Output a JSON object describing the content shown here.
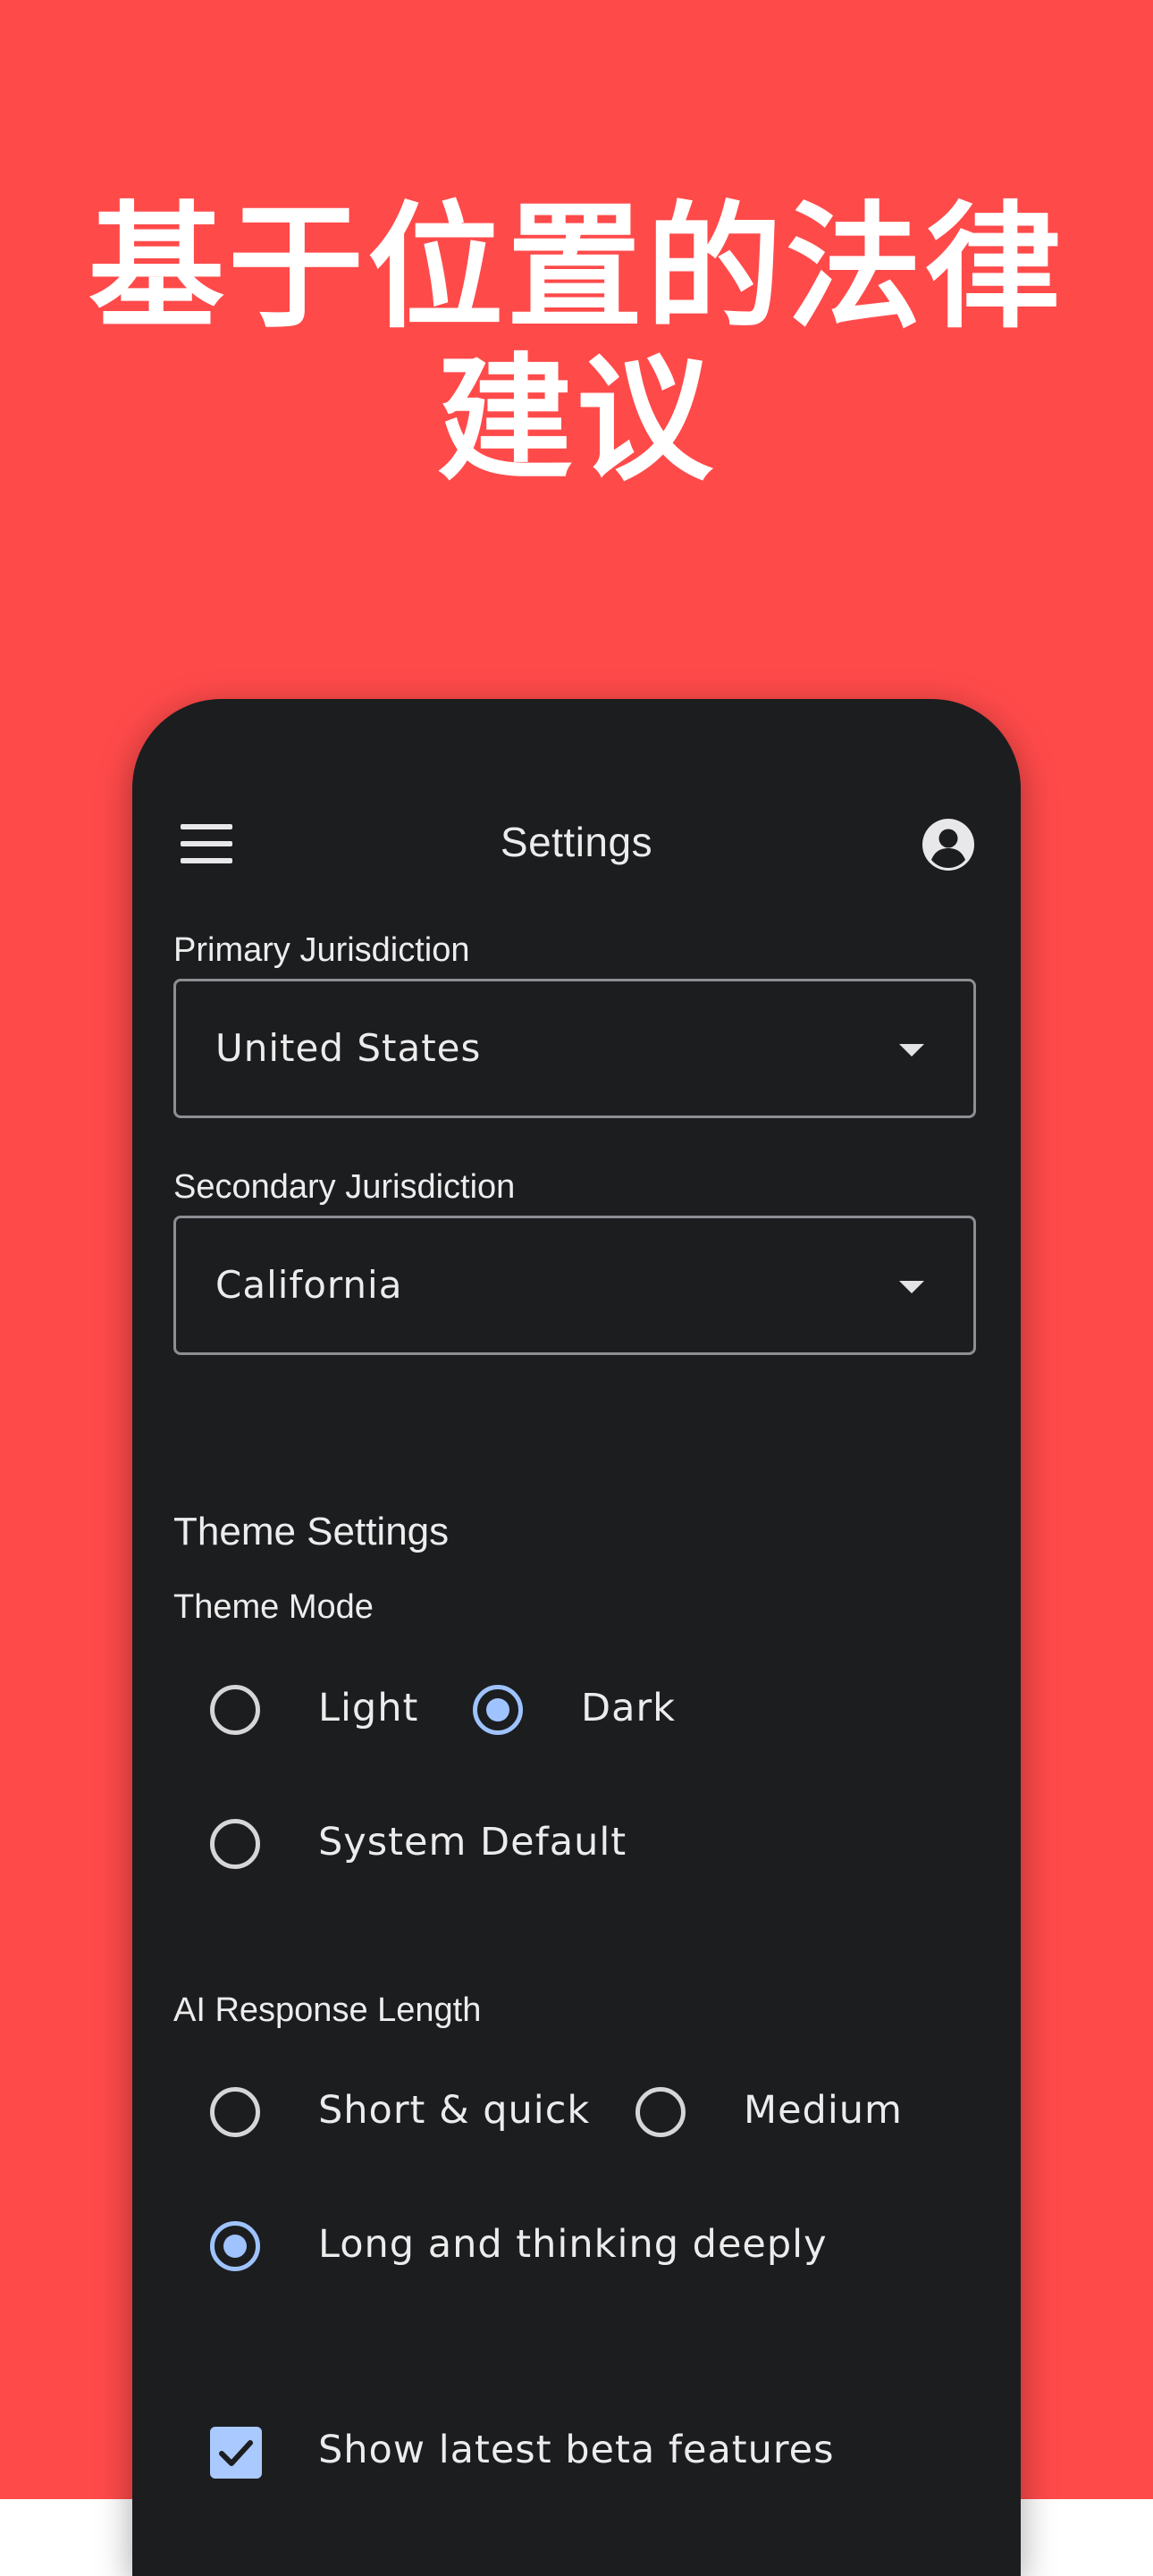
{
  "headline": {
    "line1": "基于位置的法律",
    "line2": "建议"
  },
  "topbar": {
    "title": "Settings",
    "menu_icon": "menu-icon",
    "profile_icon": "account-circle-icon"
  },
  "jurisdiction": {
    "primary_label": "Primary Jurisdiction",
    "primary_value": "United States",
    "secondary_label": "Secondary Jurisdiction",
    "secondary_value": "California"
  },
  "theme": {
    "section_title": "Theme Settings",
    "mode_label": "Theme Mode",
    "options": [
      {
        "label": "Light",
        "selected": false
      },
      {
        "label": "Dark",
        "selected": true
      },
      {
        "label": "System Default",
        "selected": false
      }
    ]
  },
  "ai_response": {
    "label": "AI Response Length",
    "options": [
      {
        "label": "Short & quick",
        "selected": false
      },
      {
        "label": "Medium",
        "selected": false
      },
      {
        "label": "Long and thinking deeply",
        "selected": true
      }
    ]
  },
  "beta": {
    "label": "Show latest beta features",
    "checked": true
  },
  "colors": {
    "background": "#ff4a4a",
    "phone": "#1c1d1f",
    "accent": "#9ec3ff"
  }
}
